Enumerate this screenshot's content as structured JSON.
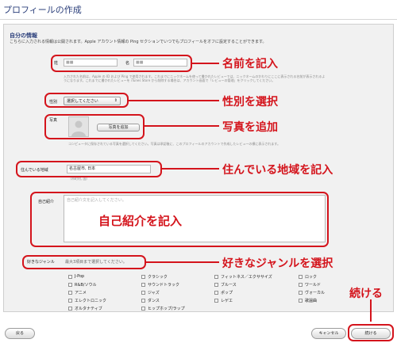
{
  "page": {
    "title": "プロフィールの作成"
  },
  "profile": {
    "section_title": "自分の情報",
    "intro": "こちらに入力される情報は公開されます。Apple アカウント情報の Ping セクションでいつでもプロフィールをオフに設定することができます。",
    "last_name_label": "姓",
    "last_name_value": "■■",
    "first_name_label": "名",
    "first_name_value": "■■",
    "name_note": "入力された名前は、Apple の ID および Ping で使用されます。これまでにニックネームを使って書かれたレビューでは、ニックネームのかわりにここに表示される名前が表示されるようになります。これまでに書かれたレビューを iTunes Store から削除する場合は、アカウント画面で「レビューの管理」をクリックしてください。",
    "gender_label": "性別",
    "gender_value": "選択してください",
    "photo_label": "写真",
    "photo_button": "写真を追加",
    "photo_note": "コンピュータに保存されている写真を選択してください。写真は承認後に、このプロフィールのアカウントで作成したレビューの横に表示されます。",
    "location_label": "住んでいる地域",
    "location_value": "名古屋市, 日本",
    "location_example": "（市町村, 国）",
    "about_label": "自己紹介",
    "about_placeholder": "自己紹介文を記入してください。",
    "genre_label": "好きなジャンル",
    "genre_hint": "最大3項目まで選択してください。",
    "genres": [
      [
        "J-Pop",
        "R&B/ソウル",
        "アニメ",
        "エレクトロニック",
        "オルタナティブ"
      ],
      [
        "クラシック",
        "サウンドトラック",
        "ジャズ",
        "ダンス",
        "ヒップホップ/ラップ"
      ],
      [
        "フィットネス／エクササイズ",
        "ブルース",
        "ポップ",
        "レゲエ"
      ],
      [
        "ロック",
        "ワールド",
        "ヴォーカル",
        "歌謡曲"
      ]
    ]
  },
  "callouts": {
    "name": "名前を記入",
    "gender": "性別を選択",
    "photo": "写真を追加",
    "location": "住んでいる地域を記入",
    "about": "自己紹介を記入",
    "genre": "好きなジャンルを選択",
    "continue": "続ける"
  },
  "footer": {
    "back": "戻る",
    "cancel": "キャンセル",
    "continue": "続ける"
  },
  "colors": {
    "accent_red": "#d4141c",
    "title_blue": "#2a3e7a"
  }
}
